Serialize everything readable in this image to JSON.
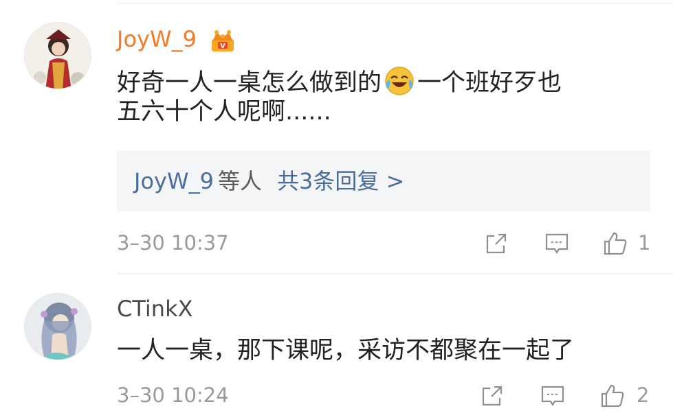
{
  "comments": [
    {
      "username": "JoyW_9",
      "vip": true,
      "content_line1_a": "好奇一人一桌怎么做到的",
      "content_line1_b": "一个班好歹也",
      "content_line2": "五六十个人呢啊......",
      "emoji": "laugh-cry-emoji",
      "reply_preview_user": "JoyW_9",
      "reply_preview_suffix": "等人",
      "reply_preview_count": "共3条回复 >",
      "timestamp": "3–30 10:37",
      "like_count": "1"
    },
    {
      "username": "CTinkX",
      "vip": false,
      "content": "一人一桌，那下课呢，采访不都聚在一起了",
      "timestamp": "3–30 10:24",
      "like_count": "2"
    }
  ],
  "colors": {
    "vip_name": "#f07b2a",
    "link_blue": "#4a6d9a",
    "meta_gray": "#9a9a9a",
    "reply_bg": "#f4f5f7"
  },
  "icons": {
    "share": "share-icon",
    "comment": "comment-icon",
    "like": "thumbs-up-icon",
    "crown": "crown-vip-icon"
  }
}
